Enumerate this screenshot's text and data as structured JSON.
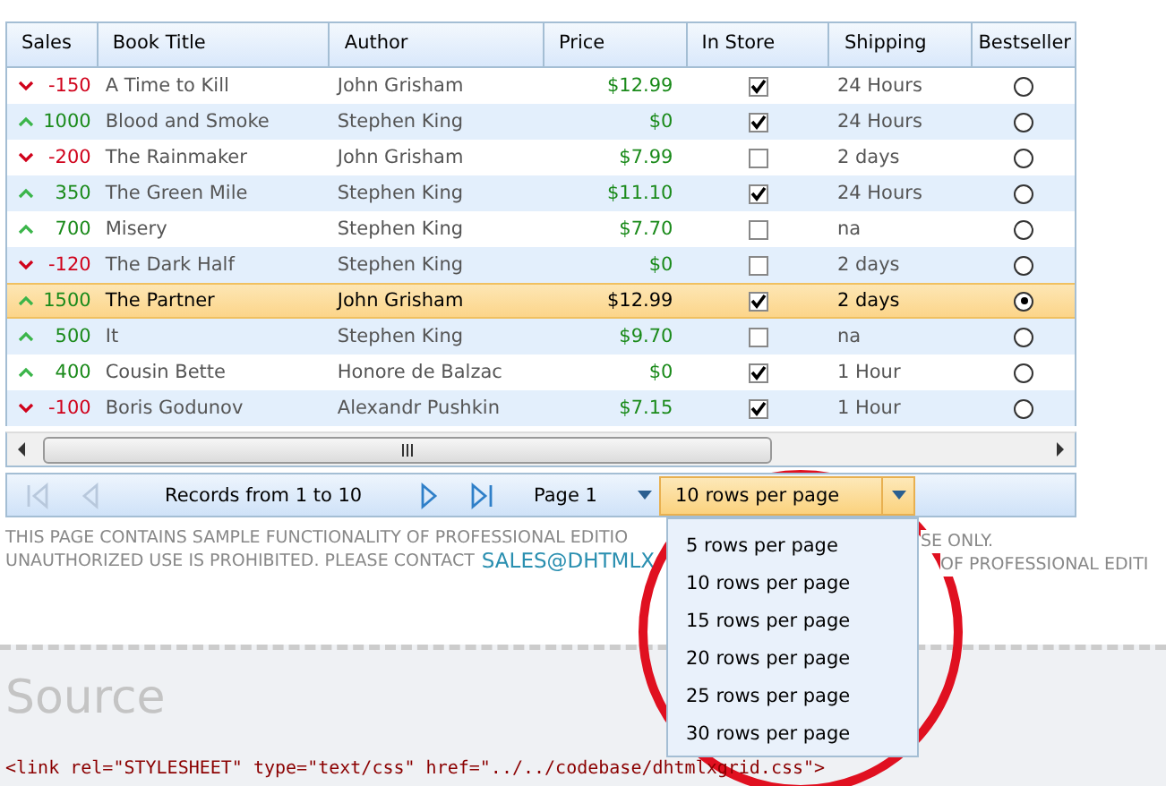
{
  "grid": {
    "columns": [
      "Sales",
      "Book Title",
      "Author",
      "Price",
      "In Store",
      "Shipping",
      "Bestseller"
    ],
    "rows": [
      {
        "kind": "down",
        "sales": "-150",
        "title": "A Time to Kill",
        "author": "John Grisham",
        "price": "$12.99",
        "in_store": true,
        "shipping": "24 Hours",
        "bestseller": false,
        "selected": false
      },
      {
        "kind": "up",
        "sales": "1000",
        "title": "Blood and Smoke",
        "author": "Stephen King",
        "price": "$0",
        "in_store": true,
        "shipping": "24 Hours",
        "bestseller": false,
        "selected": false
      },
      {
        "kind": "down",
        "sales": "-200",
        "title": "The Rainmaker",
        "author": "John Grisham",
        "price": "$7.99",
        "in_store": false,
        "shipping": "2 days",
        "bestseller": false,
        "selected": false
      },
      {
        "kind": "up",
        "sales": "350",
        "title": "The Green Mile",
        "author": "Stephen King",
        "price": "$11.10",
        "in_store": true,
        "shipping": "24 Hours",
        "bestseller": false,
        "selected": false
      },
      {
        "kind": "up",
        "sales": "700",
        "title": "Misery",
        "author": "Stephen King",
        "price": "$7.70",
        "in_store": false,
        "shipping": "na",
        "bestseller": false,
        "selected": false
      },
      {
        "kind": "down",
        "sales": "-120",
        "title": "The Dark Half",
        "author": "Stephen King",
        "price": "$0",
        "in_store": false,
        "shipping": "2 days",
        "bestseller": false,
        "selected": false
      },
      {
        "kind": "up",
        "sales": "1500",
        "title": "The Partner",
        "author": "John Grisham",
        "price": "$12.99",
        "in_store": true,
        "shipping": "2 days",
        "bestseller": true,
        "selected": true
      },
      {
        "kind": "up",
        "sales": "500",
        "title": "It",
        "author": "Stephen King",
        "price": "$9.70",
        "in_store": false,
        "shipping": "na",
        "bestseller": false,
        "selected": false
      },
      {
        "kind": "up",
        "sales": "400",
        "title": "Cousin Bette",
        "author": "Honore de Balzac",
        "price": "$0",
        "in_store": true,
        "shipping": "1 Hour",
        "bestseller": false,
        "selected": false
      },
      {
        "kind": "down",
        "sales": "-100",
        "title": "Boris Godunov",
        "author": "Alexandr Pushkin",
        "price": "$7.15",
        "in_store": true,
        "shipping": "1 Hour",
        "bestseller": false,
        "selected": false
      }
    ]
  },
  "pager": {
    "first_disabled": true,
    "prev_disabled": true,
    "next_disabled": false,
    "last_disabled": false,
    "records": "Records from 1 to 10",
    "page": "Page 1",
    "rows_per_page": "10 rows per page",
    "options": [
      {
        "label": "5 rows per page",
        "selected": false
      },
      {
        "label": "10 rows per page",
        "selected": false
      },
      {
        "label": "15 rows per page",
        "selected": false
      },
      {
        "label": "20 rows per page",
        "selected": false
      },
      {
        "label": "25 rows per page",
        "selected": false
      },
      {
        "label": "30 rows per page",
        "selected": false
      }
    ]
  },
  "notice": {
    "line_1_left": "THIS PAGE CONTAINS SAMPLE FUNCTIONALITY OF PROFESSIONAL EDITIO",
    "line_1_right": "SE ONLY.",
    "line_2_left": "UNAUTHORIZED USE IS PROHIBITED. PLEASE CONTACT",
    "line_2_link": "SALES@DHTMLX",
    "line_2_right": "OF PROFESSIONAL EDITI"
  },
  "source": {
    "heading": "Source",
    "code": "<link rel=\"STYLESHEET\" type=\"text/css\" href=\"../../codebase/dhtmlxgrid.css\">"
  }
}
